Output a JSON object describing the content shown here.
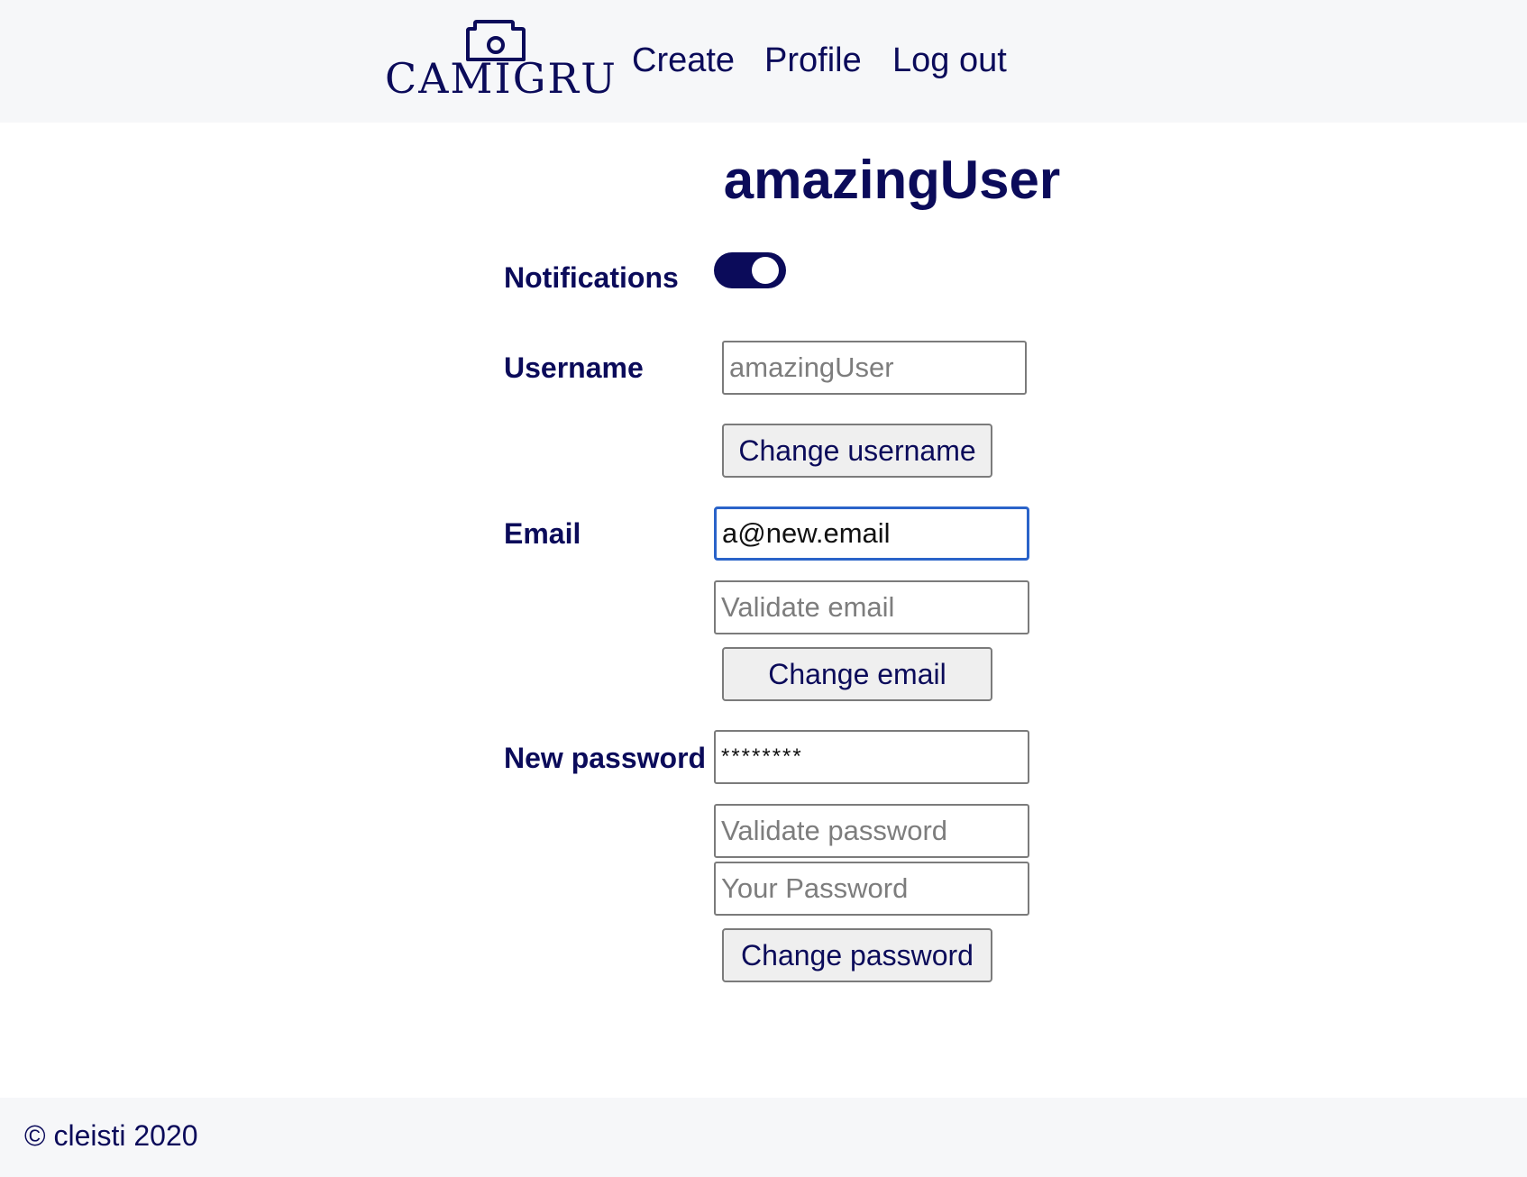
{
  "header": {
    "logo_text": "CAMIGRU",
    "nav": {
      "create": "Create",
      "profile": "Profile",
      "logout": "Log out"
    }
  },
  "profile": {
    "title": "amazingUser",
    "notifications": {
      "label": "Notifications",
      "enabled": true
    },
    "username": {
      "label": "Username",
      "placeholder": "amazingUser",
      "value": "",
      "button": "Change username"
    },
    "email": {
      "label": "Email",
      "value": "a@new.email",
      "validate_placeholder": "Validate email",
      "button": "Change email"
    },
    "password": {
      "label": "New password",
      "value": "********",
      "validate_placeholder": "Validate password",
      "current_placeholder": "Your Password",
      "button": "Change password"
    }
  },
  "footer": {
    "text": "© cleisti 2020"
  },
  "colors": {
    "text": "#0b0b5a",
    "header_bg": "#f6f7f9",
    "focus_border": "#2a63c9"
  }
}
